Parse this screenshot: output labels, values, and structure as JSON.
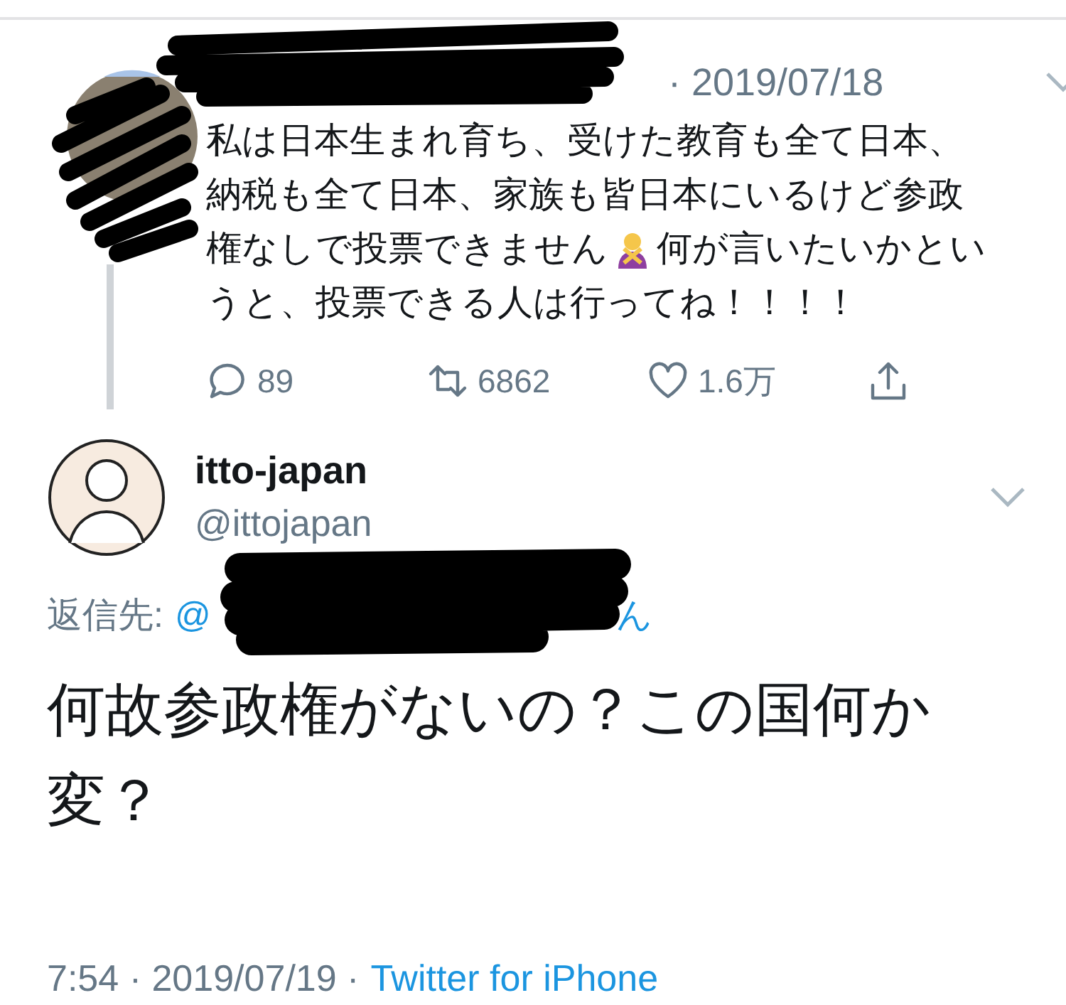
{
  "parent_tweet": {
    "timestamp": "· 2019/07/18",
    "lines": [
      {
        "before": "私は日本生まれ育ち、受けた教育も全て日本、"
      },
      {
        "before": "納税も全て日本、家族も皆日本にいるけど参政"
      },
      {
        "before": "権なしで投票できません",
        "emoji": true,
        "after": "何が言いたいかとい"
      },
      {
        "before": "うと、投票できる人は行ってね！！！！"
      }
    ],
    "stats": [
      {
        "kind": "reply",
        "count": "89"
      },
      {
        "kind": "retweet",
        "count": "6862"
      },
      {
        "kind": "like",
        "count": "1.6万"
      },
      {
        "kind": "share"
      }
    ]
  },
  "tweet": {
    "name": "itto-japan",
    "handle": "@ittojapan",
    "reply_to": {
      "label": "返信先:",
      "prefix": "@",
      "suffix": "ん"
    },
    "text": "何故参政権がないの？この国何か変？",
    "time": "7:54 · 2019/07/19 ·",
    "source": "Twitter for iPhone"
  }
}
